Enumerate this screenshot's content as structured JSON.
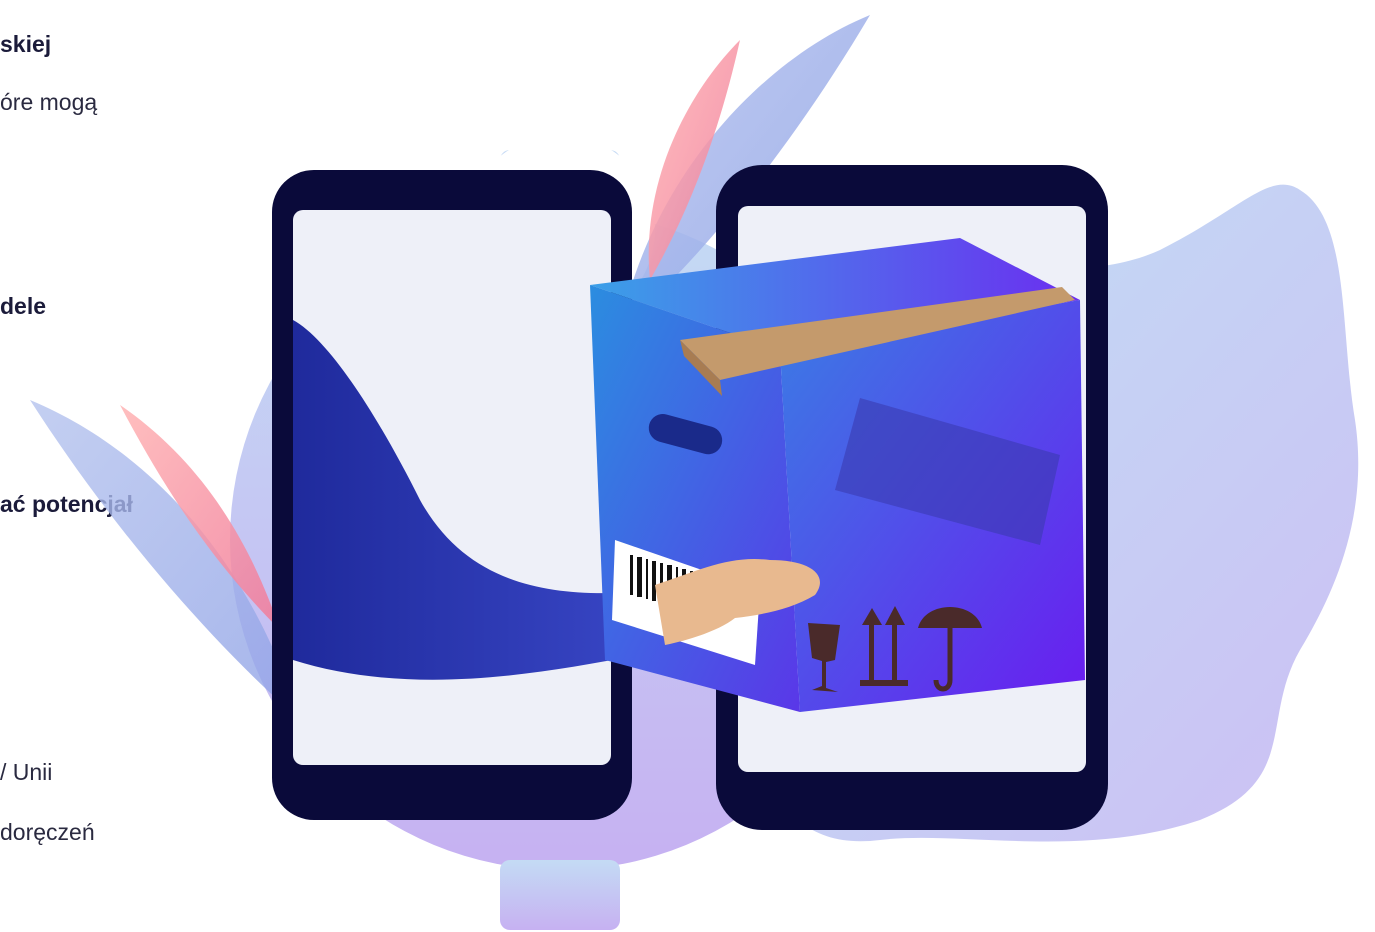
{
  "text_fragments": {
    "line1": "skiej",
    "line2": "óre mogą",
    "line3": "dele",
    "line4": "ać potencjał",
    "line5": "/ Unii",
    "line6": "doręczeń"
  },
  "illustration": {
    "subject": "hand-passing-parcel-between-smartphones",
    "palette": {
      "phone_frame": "#0a0a3a",
      "phone_screen": "#eef0f8",
      "box_front": "#3b4ee0",
      "box_side": "#5b2fe6",
      "tape": "#c49a6c",
      "sleeve": "#2732a8",
      "skin": "#e8b98f",
      "blob_light": "#bcd8f2",
      "gear": "#c9d3f4",
      "leaf_pink": "#f08aa0"
    },
    "icons": [
      "fragile-icon",
      "this-way-up-icon",
      "keep-dry-icon",
      "barcode-icon"
    ]
  }
}
